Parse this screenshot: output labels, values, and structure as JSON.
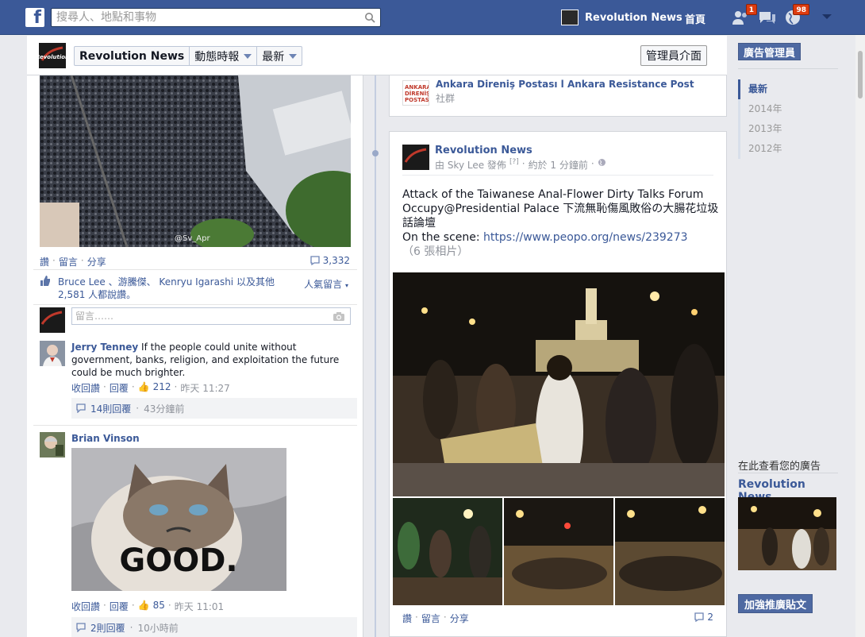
{
  "topbar": {
    "logo": "f",
    "search_placeholder": "搜尋人、地點和事物",
    "page_name": "Revolution News",
    "home": "首頁",
    "friend_requests": "1",
    "notifications": "98"
  },
  "header": {
    "page_name": "Revolution News",
    "view": "動態時報",
    "sort": "最新",
    "admin_button": "管理員介面"
  },
  "left_post": {
    "photo_credit": "@Sv_Apr",
    "actions": {
      "like": "讚",
      "comment": "留言",
      "share": "分享"
    },
    "comment_count": "3,332",
    "likes_text_1": "Bruce Lee 、游騰傑、 Kenryu Igarashi 以及其他",
    "likes_text_2": "2,581 人都說讚。",
    "top_comments": "人氣留言",
    "comment_placeholder": "留言……",
    "comments": [
      {
        "author": "Jerry Tenney",
        "text": "If the people could unite without government, banks, religion, and exploitation the future could be much brighter.",
        "unlike": "收回讚",
        "reply": "回覆",
        "likes": "212",
        "time": "昨天 11:27",
        "replies": "14則回覆",
        "reply_time": "43分鐘前"
      },
      {
        "author": "Brian Vinson",
        "image_text": "GOOD.",
        "unlike": "收回讚",
        "reply": "回覆",
        "likes": "85",
        "time": "昨天 11:01",
        "replies": "2則回覆",
        "reply_time": "10小時前"
      }
    ]
  },
  "right_top": {
    "name": "Ankara Direniş Postası l Ankara Resistance Post",
    "type": "社群"
  },
  "post": {
    "page_name": "Revolution News",
    "by": "由 Sky Lee 發佈",
    "bracket": "[?]",
    "time": "約於 1 分鐘前",
    "text_line1": "Attack of the Taiwanese Anal-Flower Dirty Talks Forum",
    "text_line2": "Occupy@Presidential Palace 下流無恥傷風敗俗の大腸花垃圾話論壇",
    "scene_label": "On the scene:",
    "link": "https://www.peopo.org/news/239273",
    "photo_count": "（6 張相片）",
    "actions": {
      "like": "讚",
      "comment": "留言",
      "share": "分享"
    },
    "comment_count": "2"
  },
  "sidebar": {
    "ads_manager": "廣告管理員",
    "years": [
      "最新",
      "2014年",
      "2013年",
      "2012年"
    ],
    "ad_heading": "在此查看您的廣告",
    "ad_page": "Revolution News",
    "boost": "加強推廣貼文"
  },
  "colors": {
    "brand": "#3b5998",
    "badge": "#dd3c10",
    "bg": "#e9eaee"
  }
}
